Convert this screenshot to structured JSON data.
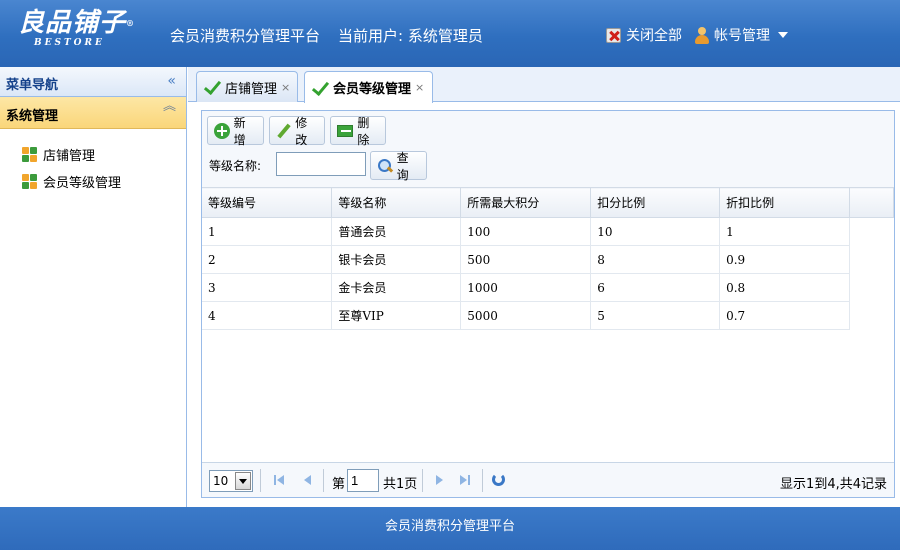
{
  "header": {
    "logo_text": "良品铺子",
    "logo_sub": "BESTORE",
    "logo_reg": "®",
    "app_title": "会员消费积分管理平台",
    "current_user": "当前用户: 系统管理员",
    "close_all_label": "关闭全部",
    "account_label": "帐号管理"
  },
  "sidebar": {
    "nav_title": "菜单导航",
    "collapse_glyph": "«",
    "section_title": "系统管理",
    "section_glyph": "︽",
    "items": [
      {
        "label": "店铺管理"
      },
      {
        "label": "会员等级管理"
      }
    ]
  },
  "tabs": [
    {
      "label": "店铺管理",
      "close": "×",
      "active": false
    },
    {
      "label": "会员等级管理",
      "close": "×",
      "active": true
    }
  ],
  "toolbar": {
    "add_label": "新增",
    "edit_label": "修改",
    "delete_label": "删除",
    "search_label": "等级名称:",
    "search_value": "",
    "search_button": "查询"
  },
  "grid": {
    "columns": [
      "等级编号",
      "等级名称",
      "所需最大积分",
      "扣分比例",
      "折扣比例"
    ],
    "rows": [
      [
        "1",
        "普通会员",
        "100",
        "10",
        "1"
      ],
      [
        "2",
        "银卡会员",
        "500",
        "8",
        "0.9"
      ],
      [
        "3",
        "金卡会员",
        "1000",
        "6",
        "0.8"
      ],
      [
        "4",
        "至尊VIP",
        "5000",
        "5",
        "0.7"
      ]
    ]
  },
  "pager": {
    "page_size": "10",
    "page_prefix": "第",
    "page_value": "1",
    "page_total": "共1页",
    "summary": "显示1到4,共4记录"
  },
  "footer": {
    "text": "会员消费积分管理平台"
  },
  "colors": {
    "header_blue": "#2f6fbf",
    "accordion_yellow": "#fad67a",
    "border_blue": "#99bbe8"
  }
}
